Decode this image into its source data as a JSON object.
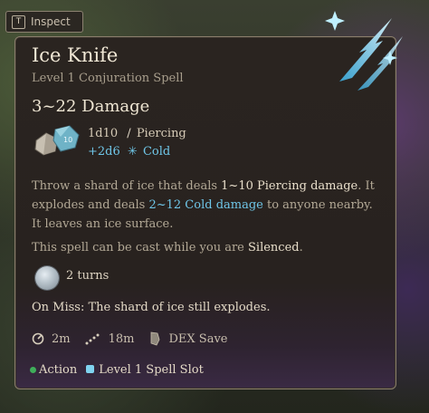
{
  "inspect": {
    "key": "T",
    "label": "Inspect"
  },
  "spell": {
    "name": "Ice Knife",
    "subtitle": "Level 1 Conjuration Spell",
    "damage_summary": "3~22 Damage",
    "damage_rows": [
      {
        "dice": "1d10",
        "type": "Piercing"
      },
      {
        "dice": "+2d6",
        "type": "Cold"
      }
    ],
    "description": {
      "p1": "Throw a shard of ice that deals ",
      "p1_hl": "1~10 Piercing damage",
      "p2": ". It explodes and deals ",
      "p2_hl": "2~12 Cold damage",
      "p3": " to anyone nearby. It leaves an ice surface."
    },
    "silence": {
      "pre": "This spell can be cast while you are ",
      "hl": "Silenced",
      "post": "."
    },
    "duration": "2 turns",
    "on_miss": "On Miss: The shard of ice still explodes.",
    "stats": {
      "radius": "2m",
      "range": "18m",
      "save": "DEX Save"
    },
    "footer": {
      "action": "Action",
      "slot": "Level 1 Spell Slot"
    }
  },
  "colors": {
    "accent_blue": "#6fc6e8",
    "action_green": "#3fae5a",
    "slot_blue": "#7fd3ef"
  }
}
